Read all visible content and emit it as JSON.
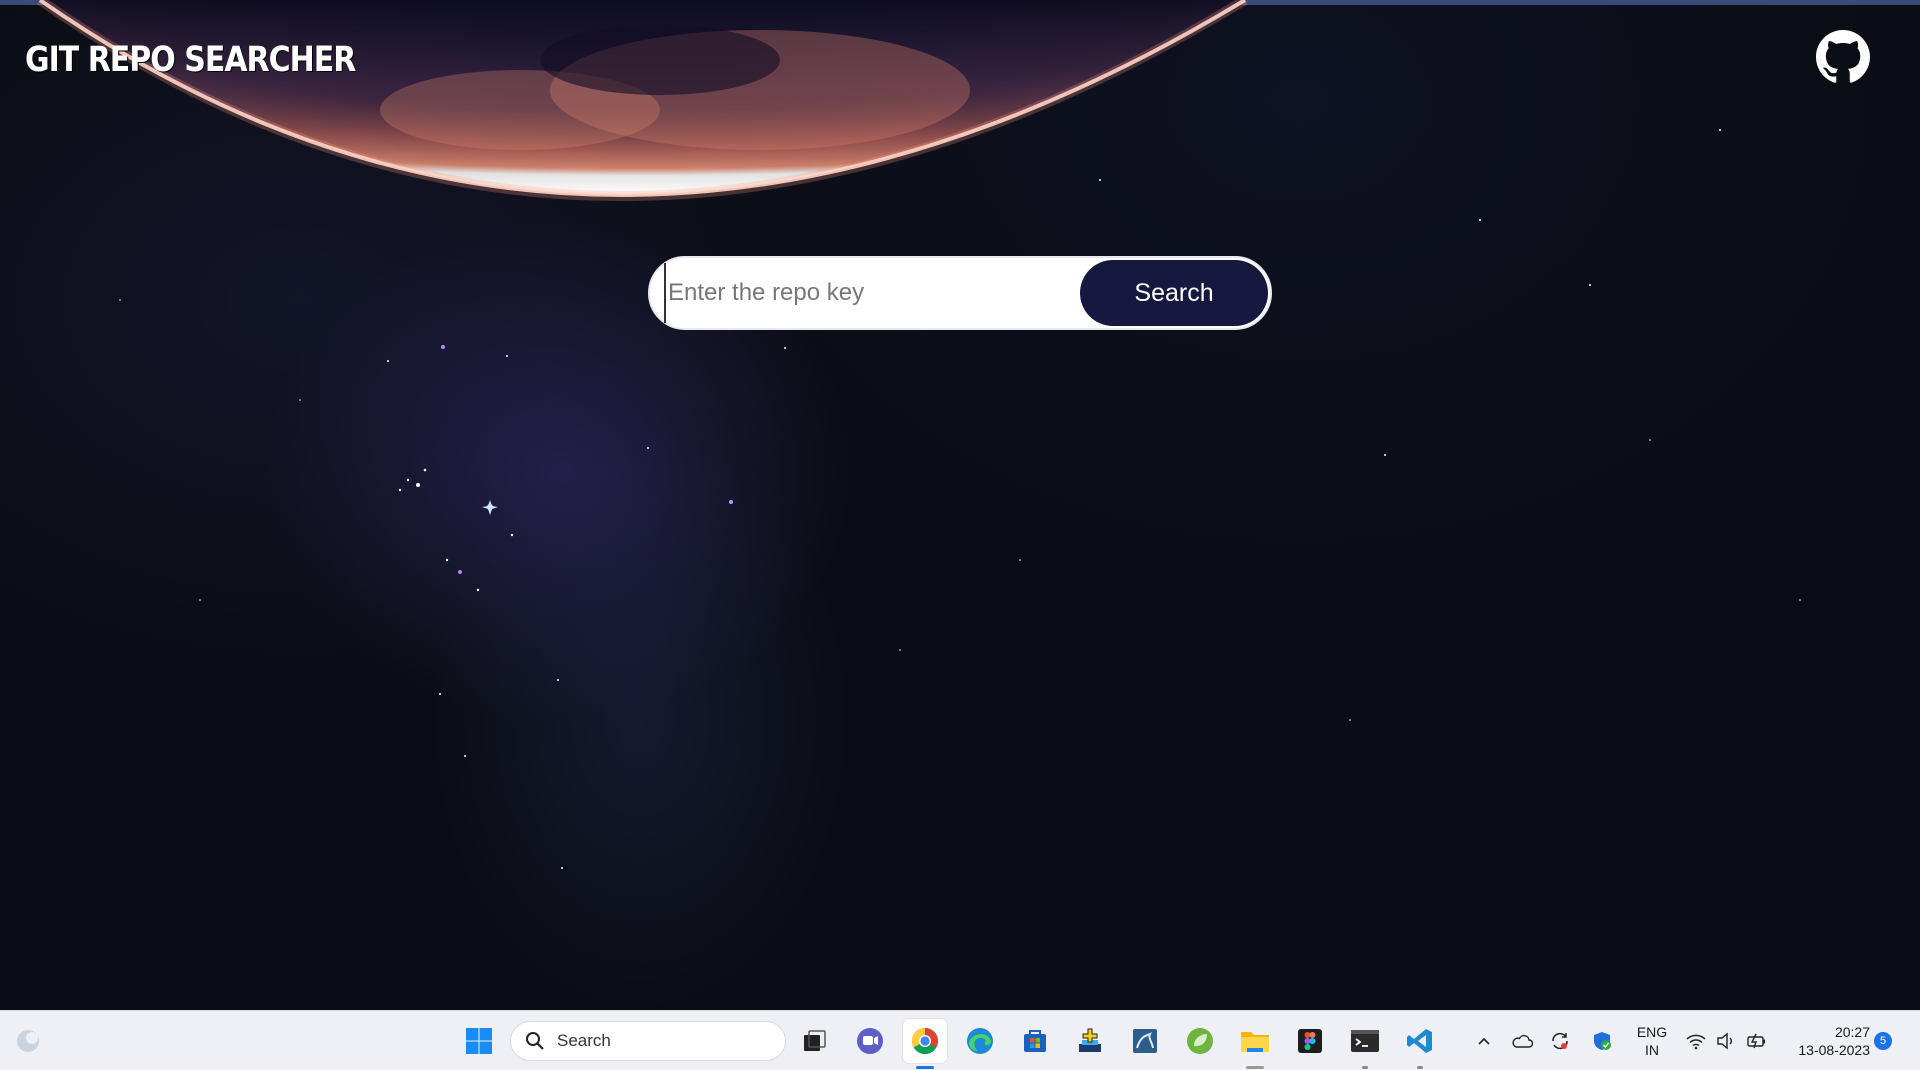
{
  "app": {
    "title": "GIT REPO SEARCHER",
    "github_icon": "github-icon"
  },
  "search": {
    "placeholder": "Enter the repo key",
    "value": "",
    "button_label": "Search"
  },
  "taskbar": {
    "search_label": "Search",
    "apps": [
      {
        "name": "start",
        "icon": "windows-start-icon"
      },
      {
        "name": "task-view",
        "icon": "task-view-icon"
      },
      {
        "name": "teams",
        "icon": "teams-chat-icon"
      },
      {
        "name": "chrome",
        "icon": "chrome-icon",
        "active": true
      },
      {
        "name": "edge",
        "icon": "edge-icon"
      },
      {
        "name": "store",
        "icon": "store-icon"
      },
      {
        "name": "game",
        "icon": "game-icon"
      },
      {
        "name": "mysql",
        "icon": "mysql-workbench-icon"
      },
      {
        "name": "spring",
        "icon": "spring-tools-icon"
      },
      {
        "name": "file-explorer",
        "icon": "folder-icon"
      },
      {
        "name": "figma",
        "icon": "figma-icon"
      },
      {
        "name": "terminal",
        "icon": "terminal-icon"
      },
      {
        "name": "vscode",
        "icon": "vscode-icon"
      }
    ],
    "tray": {
      "language_line1": "ENG",
      "language_line2": "IN",
      "time": "20:27",
      "date": "13-08-2023",
      "notification_count": "5"
    }
  },
  "colors": {
    "search_button_bg": "#17183f",
    "page_bg": "#0b0d14",
    "planet_glow": "#f08a72"
  }
}
